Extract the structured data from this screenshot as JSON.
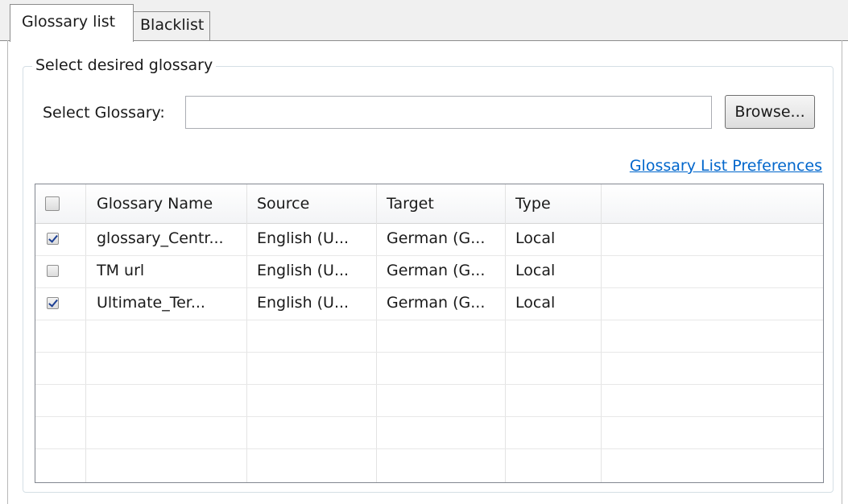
{
  "tabs": [
    {
      "label": "Glossary list",
      "active": true
    },
    {
      "label": "Blacklist",
      "active": false
    }
  ],
  "group": {
    "legend": "Select desired glossary",
    "select_label": "Select Glossary:",
    "select_value": "",
    "browse_label": "Browse...",
    "prefs_link": "Glossary List Preferences"
  },
  "table": {
    "columns": [
      "Glossary Name",
      "Source",
      "Target",
      "Type"
    ],
    "select_all_checked": false,
    "rows": [
      {
        "checked": true,
        "name": "glossary_Centr...",
        "source": "English (U...",
        "target": "German (G...",
        "type": "Local"
      },
      {
        "checked": false,
        "name": "TM url",
        "source": "English (U...",
        "target": "German (G...",
        "type": "Local"
      },
      {
        "checked": true,
        "name": "Ultimate_Ter...",
        "source": "English (U...",
        "target": "German (G...",
        "type": "Local"
      }
    ]
  },
  "colors": {
    "link": "#0066cc",
    "check": "#1c3f94"
  }
}
